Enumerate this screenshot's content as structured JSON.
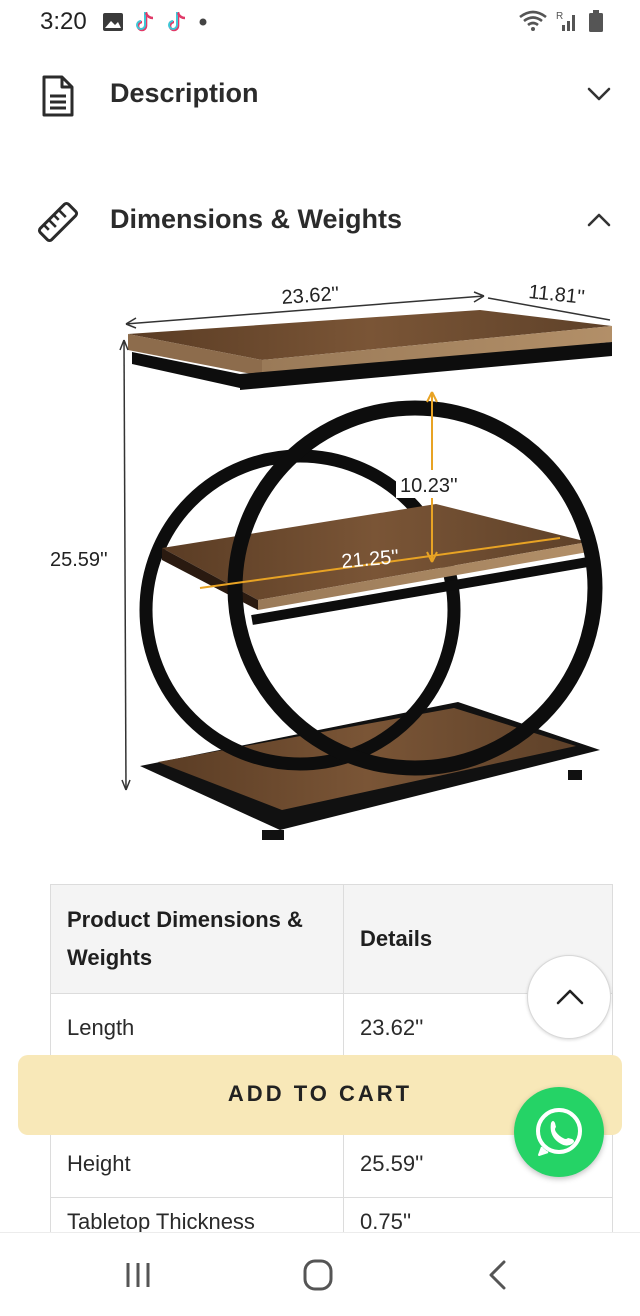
{
  "status_bar": {
    "time": "3:20",
    "left_icons": [
      "gallery-icon",
      "tiktok-icon",
      "tiktok-icon",
      "dot-icon"
    ],
    "right_icons": [
      "wifi-icon",
      "signal-icon",
      "battery-icon"
    ],
    "signal_label": "R"
  },
  "sections": {
    "description": {
      "title": "Description",
      "icon": "document-icon",
      "state": "collapsed"
    },
    "dimensions": {
      "title": "Dimensions & Weights",
      "icon": "ruler-icon",
      "state": "expanded"
    }
  },
  "product_image": {
    "dimensions": {
      "length": "23.62''",
      "depth": "11.81''",
      "height": "25.59''",
      "shelf_gap": "10.23''",
      "shelf_width": "21.25''"
    }
  },
  "table": {
    "headers": [
      "Product Dimensions & Weights",
      "Details"
    ],
    "rows": [
      {
        "label": "Length",
        "value": "23.62''"
      },
      {
        "label": "Height",
        "value": "25.59''"
      },
      {
        "label": "Tabletop Thickness",
        "value": "0.75''"
      }
    ]
  },
  "cart": {
    "label": "ADD TO CART"
  },
  "colors": {
    "cart_bar": "#f8e8b8",
    "whatsapp": "#25d366",
    "wood": "#6b4a2e",
    "frame": "#111111"
  }
}
